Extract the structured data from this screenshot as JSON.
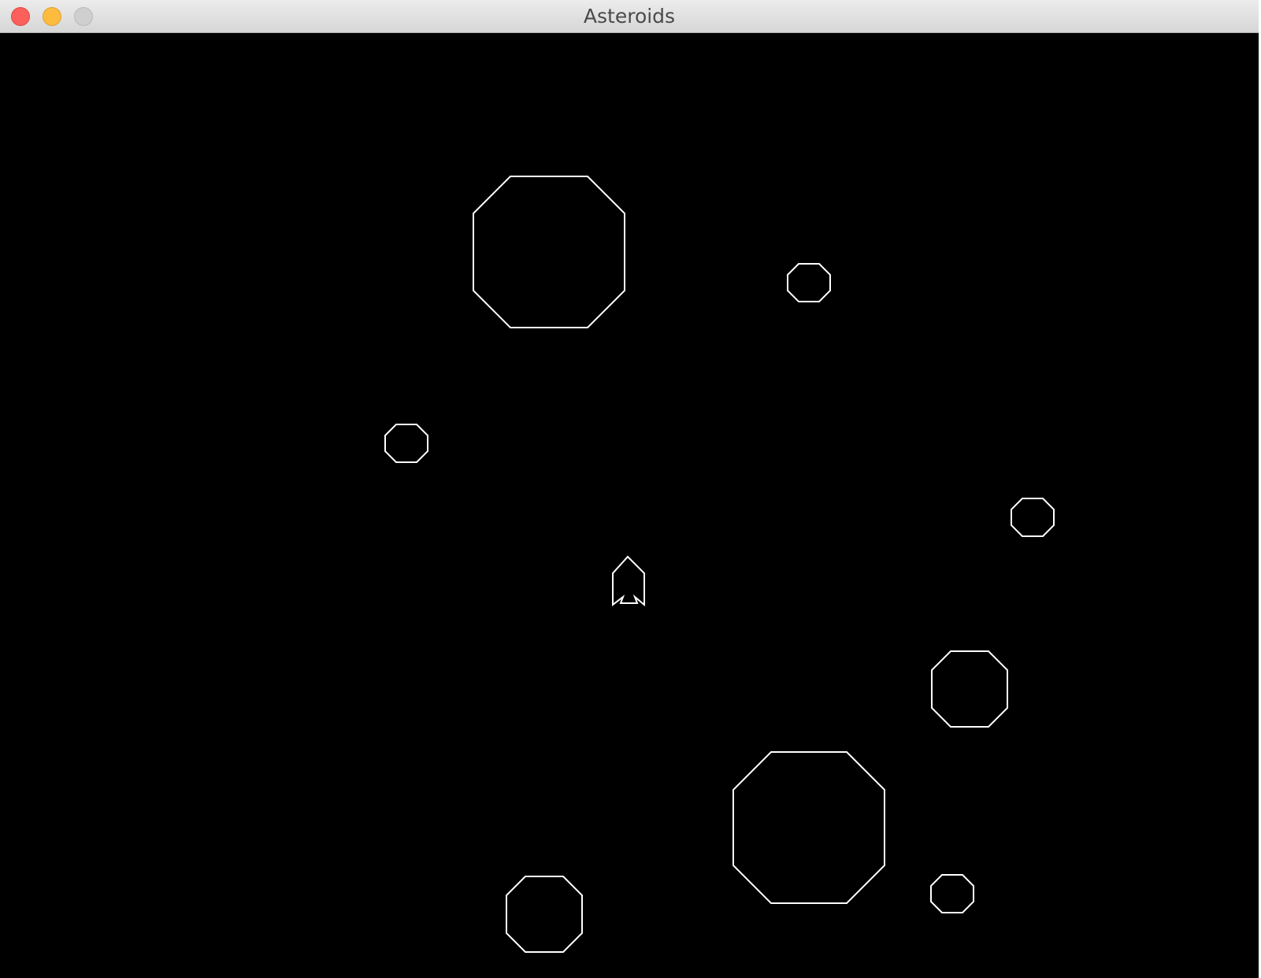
{
  "window": {
    "title": "Asteroids",
    "background_color": "#000000",
    "stroke_color": "#ffffff"
  },
  "titlebar": {
    "close_color": "#fc605c",
    "minimize_color": "#fdbc40",
    "zoom_color": "#cfcfcf"
  },
  "game": {
    "ship": {
      "shape": "rocket-outline",
      "heading": "up"
    },
    "asteroids": [
      {
        "size": "large",
        "shape": "octagon"
      },
      {
        "size": "small",
        "shape": "octagon"
      },
      {
        "size": "small",
        "shape": "octagon"
      },
      {
        "size": "small",
        "shape": "octagon"
      },
      {
        "size": "medium",
        "shape": "octagon"
      },
      {
        "size": "large",
        "shape": "octagon"
      },
      {
        "size": "medium",
        "shape": "octagon"
      },
      {
        "size": "small",
        "shape": "octagon"
      }
    ]
  }
}
